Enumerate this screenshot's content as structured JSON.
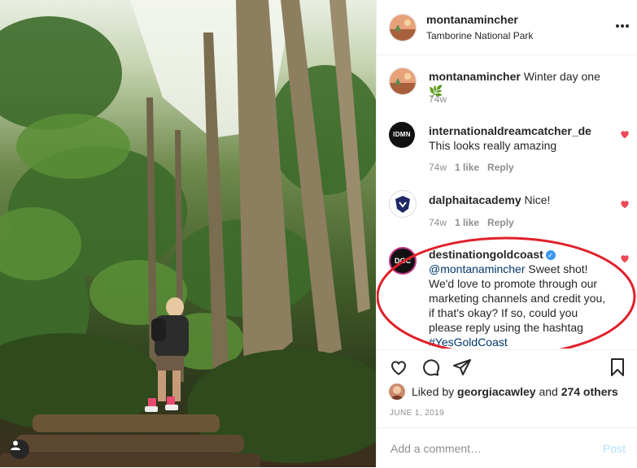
{
  "photo": {
    "alt_icon": "tag-person-icon"
  },
  "header": {
    "username": "montanamincher",
    "location": "Tamborine National Park",
    "more_icon": "more-options-icon"
  },
  "comments": [
    {
      "username": "montanamincher",
      "text": "Winter day one",
      "emoji": "🌿",
      "age": "74w"
    },
    {
      "username": "internationaldreamcatcher_de",
      "text": "This looks really amazing",
      "age": "74w",
      "likes": "1 like",
      "reply": "Reply",
      "avatar_text": "IDMN"
    },
    {
      "username": "dalphaitacademy",
      "text": "Nice!",
      "age": "74w",
      "likes": "1 like",
      "reply": "Reply"
    },
    {
      "username": "destinationgoldcoast",
      "mention": "@montanamincher",
      "text": "Sweet shot! We'd love to promote through our marketing channels and credit you, if that's okay? If so, could you please reply using the hashtag",
      "hashtag": "#YesGoldCoast",
      "avatar_text": "DGC"
    }
  ],
  "likes": {
    "prefix": "Liked by",
    "user": "georgiacawley",
    "and": "and",
    "others": "274 others"
  },
  "date": "JUNE 1, 2019",
  "add_comment": {
    "placeholder": "Add a comment…",
    "post": "Post"
  },
  "colors": {
    "heart": "#ed4956",
    "highlight": "#e0202a",
    "link": "#00376b",
    "verified": "#3897f0"
  }
}
